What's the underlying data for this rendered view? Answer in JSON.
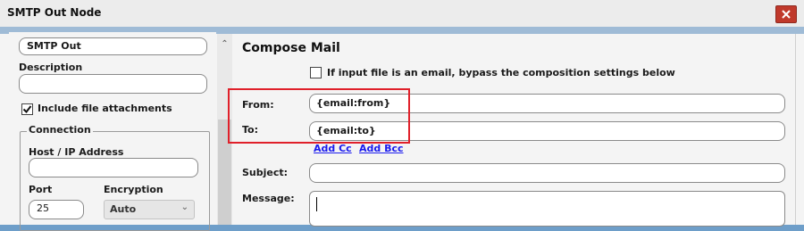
{
  "window": {
    "title": "SMTP Out Node",
    "close_icon": "close-icon"
  },
  "left": {
    "name_value": "SMTP Out",
    "description_label": "Description",
    "description_value": "",
    "include_attachments_label": "Include file attachments",
    "include_attachments_checked": true,
    "connection": {
      "title": "Connection",
      "host_label": "Host / IP Address",
      "host_value": "",
      "port_label": "Port",
      "port_value": "25",
      "encryption_label": "Encryption",
      "encryption_value": "Auto"
    }
  },
  "compose": {
    "title": "Compose Mail",
    "bypass_label": "If input file is an email, bypass the composition settings below",
    "bypass_checked": false,
    "from_label": "From:",
    "from_value": "{email:from}",
    "to_label": "To:",
    "to_value": "{email:to}",
    "add_cc": "Add Cc",
    "add_bcc": "Add Bcc",
    "subject_label": "Subject:",
    "subject_value": "",
    "message_label": "Message:",
    "message_value": ""
  },
  "colors": {
    "highlight": "#e0202a",
    "link": "#1a1aee",
    "close": "#c0392b"
  }
}
